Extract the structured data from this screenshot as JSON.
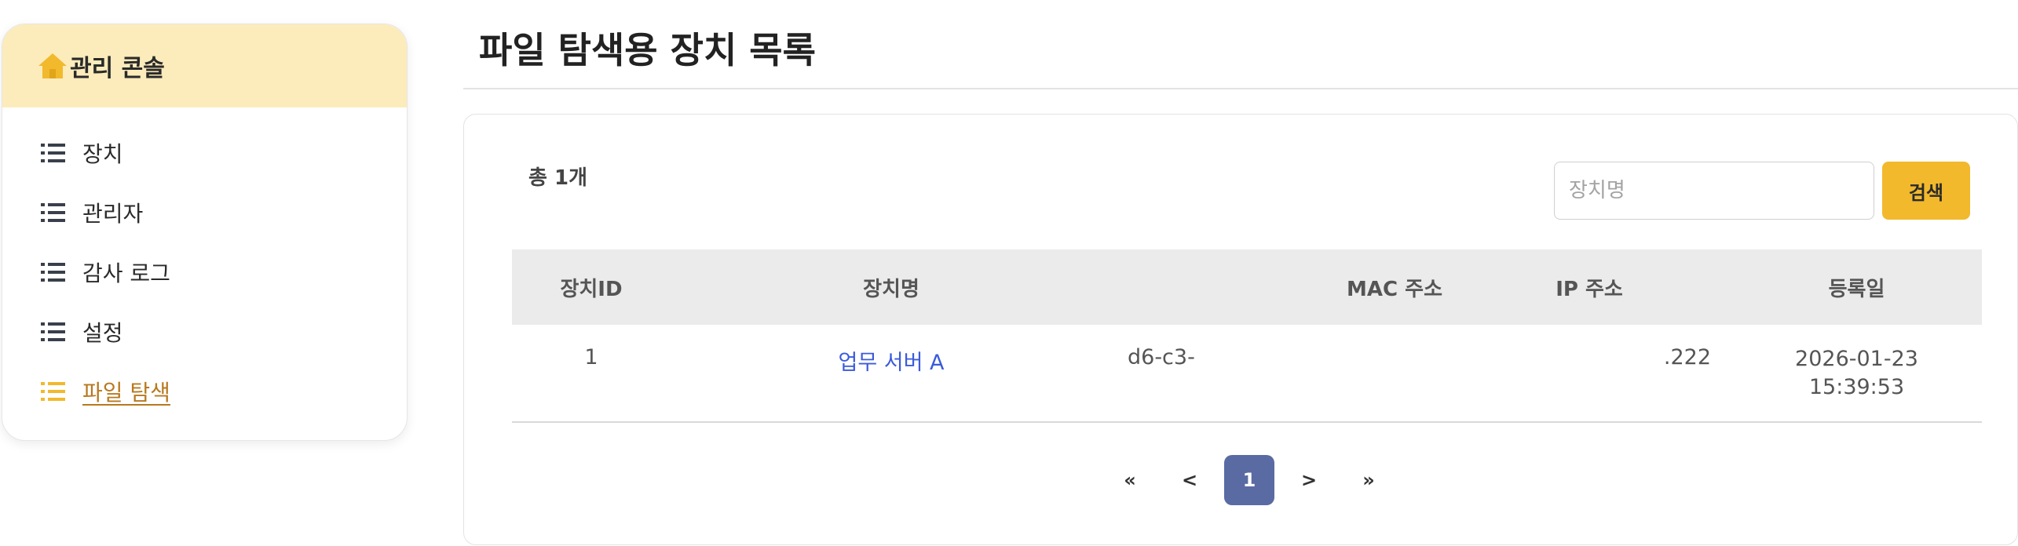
{
  "sidebar": {
    "title": "관리 콘솔",
    "items": [
      {
        "label": "장치",
        "active": false
      },
      {
        "label": "관리자",
        "active": false
      },
      {
        "label": "감사 로그",
        "active": false
      },
      {
        "label": "설정",
        "active": false
      },
      {
        "label": "파일 탐색",
        "active": true
      }
    ]
  },
  "page": {
    "title": "파일 탐색용 장치 목록"
  },
  "toolbar": {
    "total_label": "총 1개",
    "search_placeholder": "장치명",
    "search_value": "",
    "search_button": "검색"
  },
  "table": {
    "headers": {
      "id": "장치ID",
      "name": "장치명",
      "mac": "MAC 주소",
      "ip": "IP 주소",
      "date": "등록일"
    },
    "rows": [
      {
        "id": "1",
        "name": "업무 서버 A",
        "mac": "d6-c3-",
        "ip": ".222",
        "date_line1": "2026-01-23",
        "date_line2": "15:39:53"
      }
    ]
  },
  "pagination": {
    "first": "«",
    "prev": "<",
    "current": "1",
    "next": ">",
    "last": "»"
  },
  "colors": {
    "accent": "#f2b92d",
    "header_bg": "#fcecbb",
    "active_menu": "#f2b92d",
    "link": "#3b5bdb",
    "current_page": "#5a6aa3"
  },
  "icons": {
    "header": "home-icon",
    "menu": "list-icon"
  }
}
